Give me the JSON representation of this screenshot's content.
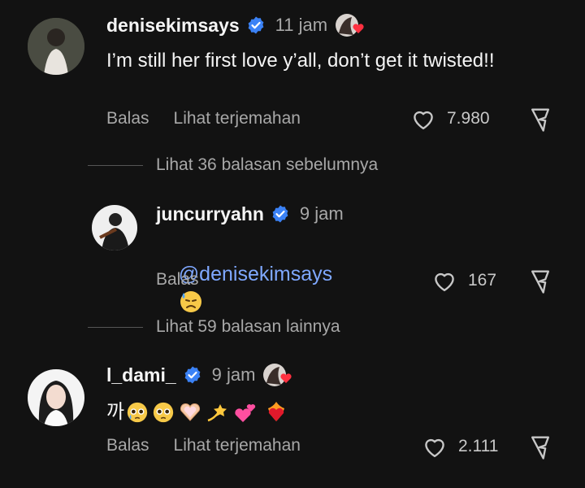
{
  "comments": [
    {
      "username": "denisekimsays",
      "verified": true,
      "time": "11 jam",
      "text": "I’m still her first love y’all, don’t get it twisted!!",
      "reply_label": "Balas",
      "translate_label": "Lihat terjemahan",
      "likes": "7.980"
    },
    {
      "username": "juncurryahn",
      "verified": true,
      "time": "9 jam",
      "mention": "@denisekimsays",
      "reply_label": "Balas",
      "likes": "167"
    },
    {
      "username": "l_dami_",
      "verified": true,
      "time": "9 jam",
      "text": "까",
      "reply_label": "Balas",
      "translate_label": "Lihat terjemahan",
      "likes": "2.111"
    }
  ],
  "view_more": {
    "previous": "Lihat 36 balasan sebelumnya",
    "more": "Lihat 59 balasan lainnya"
  },
  "icons": {
    "verified": "verified-badge-icon",
    "heart": "heart-outline-icon",
    "share": "share-icon",
    "creator_like": "creator-liked-icon"
  },
  "colors": {
    "background": "#121212",
    "verified": "#3b82f6",
    "mention": "#7fa8ff",
    "creator_heart": "#ff3040"
  }
}
